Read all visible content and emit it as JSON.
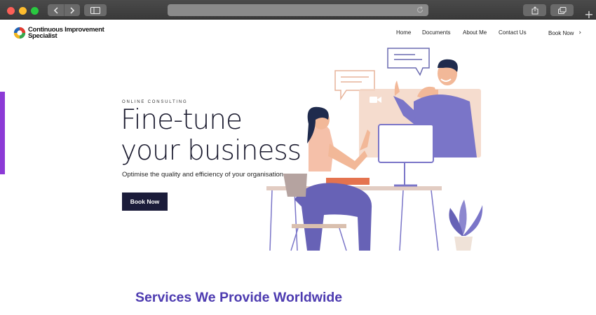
{
  "browser": {
    "icons": [
      "chevron-left-icon",
      "chevron-right-icon",
      "sidebar-icon",
      "reload-icon",
      "share-icon",
      "tabs-icon",
      "plus-icon"
    ],
    "new_tab_glyph": "+"
  },
  "header": {
    "logo_line1": "Continuous Improvement",
    "logo_line2": "Specialist",
    "nav": {
      "home": "Home",
      "documents": "Documents",
      "about": "About Me",
      "contact": "Contact Us",
      "book": "Book Now",
      "book_chevron": "›"
    }
  },
  "hero": {
    "eyebrow": "ONLINE CONSULTING",
    "title_line1": "Fine-tune",
    "title_line2": "your business",
    "subtitle": "Optimise the quality and efficiency of your organisation",
    "cta_label": "Book Now"
  },
  "services": {
    "title": "Services We Provide Worldwide"
  },
  "colors": {
    "accent_bar": "#8c3ad6",
    "cta_bg": "#1b1c3a",
    "services_title": "#4d3bb0",
    "illustration_purple": "#7a75c8",
    "illustration_peach": "#f3c9b2"
  }
}
